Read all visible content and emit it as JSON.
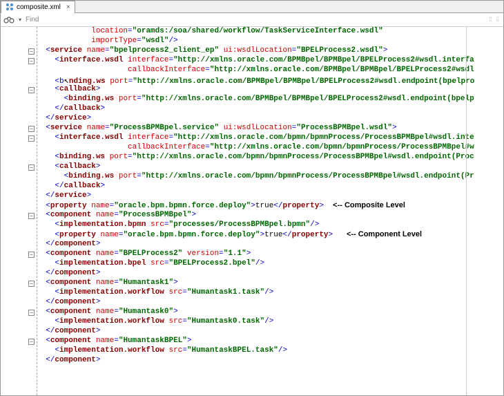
{
  "tab": {
    "title": "composite.xml"
  },
  "findbar": {
    "placeholder": "Find"
  },
  "annotations": {
    "composite_level": "<-- Composite Level",
    "component_level": "<-- Component Level"
  },
  "xml": {
    "l1_indent": "            ",
    "l1_attr": "location",
    "l1_val": "\"oramds:/soa/shared/workflow/TaskServiceInterface.wsdl\"",
    "l2_indent": "            ",
    "l2_attr": "importType",
    "l2_val": "\"wsdl\"",
    "l2_close": "/>",
    "l3_indent": "  ",
    "l3_open": "<",
    "l3_elem": "service",
    "l3_a1": "name",
    "l3_v1": "\"bpelprocess2_client_ep\"",
    "l3_a2": "ui:wsdlLocation",
    "l3_v2": "\"BPELProcess2.wsdl\"",
    "l3_end": ">",
    "l4_indent": "    ",
    "l4_elem": "interface.wsdl",
    "l4_a1": "interface",
    "l4_v1": "\"http://xmlns.oracle.com/BPMBpel/BPMBpel/BPELProcess2#wsdl.interfa",
    "l5_indent": "                    ",
    "l5_a1": "callbackInterface",
    "l5_v1": "\"http://xmlns.oracle.com/BPMBpel/BPMBpel/BPELProcess2#wsdl",
    "l6_indent": "    ",
    "l6_open": "<b",
    "l6_elem": "nding.ws",
    "l6_a1": "port",
    "l6_v1": "\"http://xmlns.oracle.com/BPMBpel/BPMBpel/BPELProcess2#wsdl.endpoint(bpelpro",
    "l7_indent": "    ",
    "l7_elem": "callback",
    "l8_indent": "      ",
    "l8_elem": "binding.ws",
    "l8_a1": "port",
    "l8_v1": "\"http://xmlns.oracle.com/BPMBpel/BPMBpel/BPELProcess2#wsdl.endpoint(bpelp",
    "l9_indent": "    ",
    "l9_close": "callback",
    "l10_indent": "  ",
    "l10_close": "service",
    "l11_indent": "  ",
    "l11_elem": "service",
    "l11_a1": "name",
    "l11_v1": "\"ProcessBPMBpel.service\"",
    "l11_a2": "ui:wsdlLocation",
    "l11_v2": "\"ProcessBPMBpel.wsdl\"",
    "l12_indent": "    ",
    "l12_elem": "interface.wsdl",
    "l12_a1": "interface",
    "l12_v1": "\"http://xmlns.oracle.com/bpmn/bpmnProcess/ProcessBPMBpel#wsdl.inte",
    "l13_indent": "                    ",
    "l13_a1": "callbackInterface",
    "l13_v1": "\"http://xmlns.oracle.com/bpmn/bpmnProcess/ProcessBPMBpel#w",
    "l14_indent": "    ",
    "l14_elem": "binding.ws",
    "l14_a1": "port",
    "l14_v1": "\"http://xmlns.oracle.com/bpmn/bpmnProcess/ProcessBPMBpel#wsdl.endpoint(Proc",
    "l15_indent": "    ",
    "l15_elem": "callback",
    "l16_indent": "      ",
    "l16_elem": "binding.ws",
    "l16_a1": "port",
    "l16_v1": "\"http://xmlns.oracle.com/bpmn/bpmnProcess/ProcessBPMBpel#wsdl.endpoint(Pr",
    "l17_indent": "    ",
    "l17_close": "callback",
    "l18_indent": "  ",
    "l18_close": "service",
    "l19_indent": "  ",
    "l19_elem": "property",
    "l19_a1": "name",
    "l19_v1": "\"oracle.bpm.bpmn.force.deploy\"",
    "l19_txt": "true",
    "l20_indent": "  ",
    "l20_elem": "component",
    "l20_a1": "name",
    "l20_v1": "\"ProcessBPMBpel\"",
    "l21_indent": "    ",
    "l21_elem": "implementation.bpmn",
    "l21_a1": "src",
    "l21_v1": "\"processes/ProcessBPMBpel.bpmn\"",
    "l22_indent": "    ",
    "l22_elem": "property",
    "l22_a1": "name",
    "l22_v1": "\"oracle.bpm.bpmn.force.deploy\"",
    "l22_txt": "true",
    "l23_indent": "  ",
    "l23_close": "component",
    "l24_indent": "  ",
    "l24_elem": "component",
    "l24_a1": "name",
    "l24_v1": "\"BPELProcess2\"",
    "l24_a2": "version",
    "l24_v2": "\"1.1\"",
    "l25_indent": "    ",
    "l25_elem": "implementation.bpel",
    "l25_a1": "src",
    "l25_v1": "\"BPELProcess2.bpel\"",
    "l26_indent": "  ",
    "l26_close": "component",
    "l27_indent": "  ",
    "l27_elem": "component",
    "l27_a1": "name",
    "l27_v1": "\"Humantask1\"",
    "l28_indent": "    ",
    "l28_elem": "implementation.workflow",
    "l28_a1": "src",
    "l28_v1": "\"Humantask1.task\"",
    "l29_indent": "  ",
    "l29_close": "component",
    "l30_indent": "  ",
    "l30_elem": "component",
    "l30_a1": "name",
    "l30_v1": "\"Humantask0\"",
    "l31_indent": "    ",
    "l31_elem": "implementation.workflow",
    "l31_a1": "src",
    "l31_v1": "\"Humantask0.task\"",
    "l32_indent": "  ",
    "l32_close": "component",
    "l33_indent": "  ",
    "l33_elem": "component",
    "l33_a1": "name",
    "l33_v1": "\"HumantaskBPEL\"",
    "l34_indent": "    ",
    "l34_elem": "implementation.workflow",
    "l34_a1": "src",
    "l34_v1": "\"HumantaskBPEL.task\"",
    "l35_indent": "  ",
    "l35_close": "component"
  }
}
